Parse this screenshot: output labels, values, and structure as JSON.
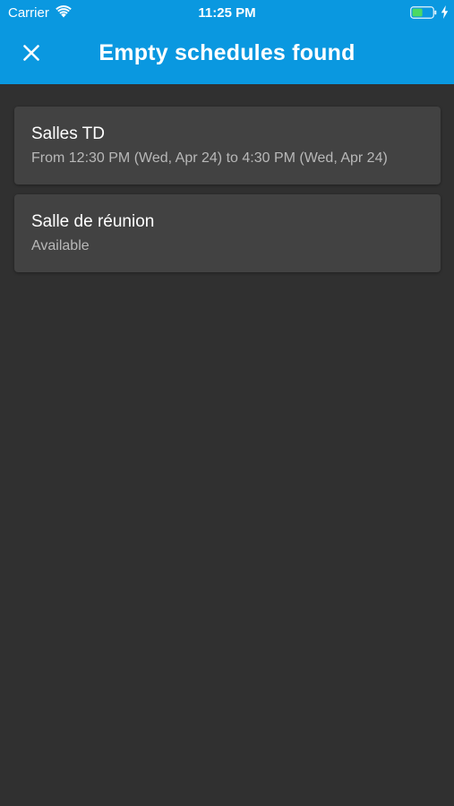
{
  "status_bar": {
    "carrier": "Carrier",
    "time": "11:25 PM",
    "icons": [
      "wifi-icon",
      "battery-icon",
      "charging-bolt-icon"
    ]
  },
  "app_bar": {
    "title": "Empty schedules found",
    "close_icon": "close-icon",
    "background_color": "#0a98e0"
  },
  "rooms": [
    {
      "name": "Salles TD",
      "detail": "From 12:30 PM (Wed, Apr 24) to 4:30 PM (Wed, Apr 24)"
    },
    {
      "name": "Salle de réunion",
      "detail": "Available"
    }
  ],
  "colors": {
    "background": "#303030",
    "card": "#424242",
    "battery_fill": "#4cd964"
  }
}
